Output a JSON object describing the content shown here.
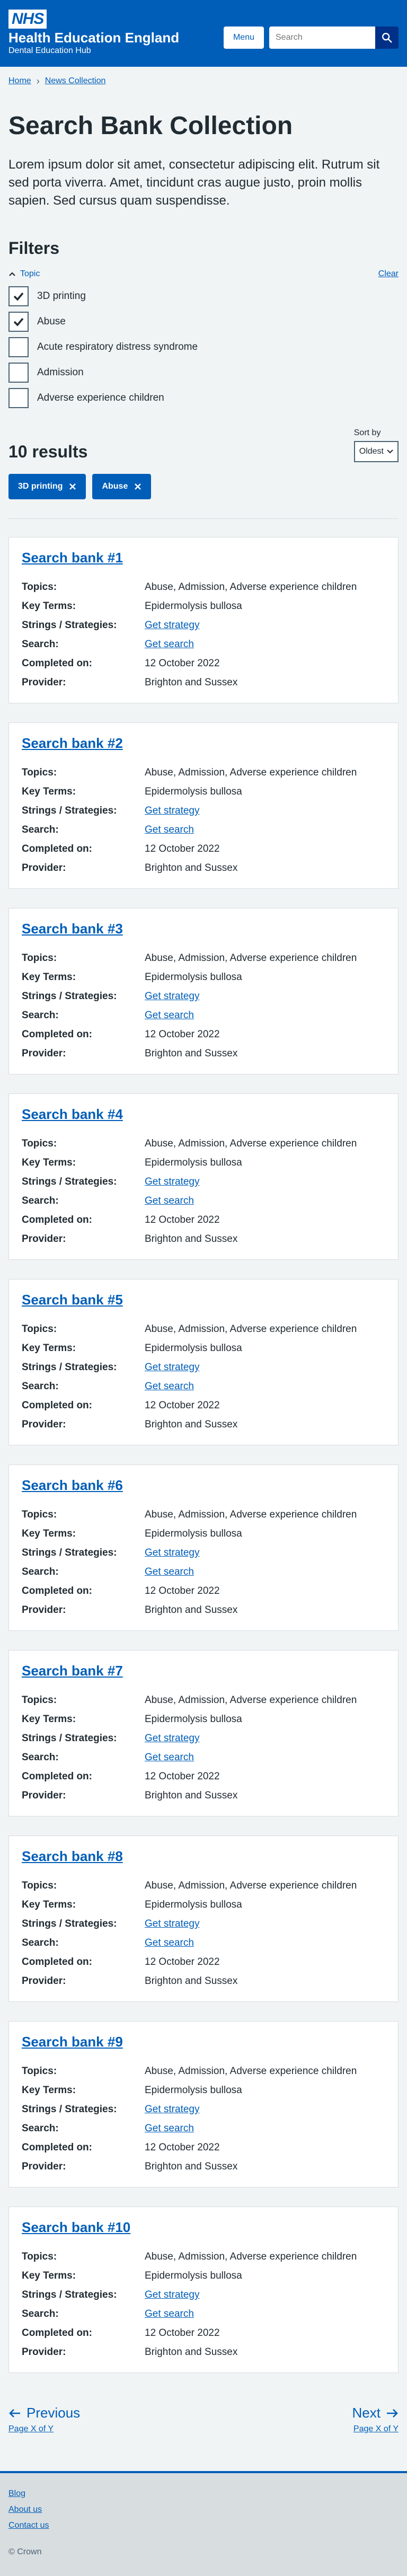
{
  "header": {
    "logo_text": "NHS",
    "org_name": "Health Education England",
    "org_sub": "Dental Education Hub",
    "menu_label": "Menu",
    "search_placeholder": "Search",
    "icons": {
      "search": "search-icon"
    },
    "colors": {
      "brand": "#005eb8",
      "dark": "#003087"
    }
  },
  "breadcrumb": {
    "items": [
      "Home",
      "News Collection"
    ]
  },
  "page": {
    "title": "Search Bank Collection",
    "lead": "Lorem ipsum dolor sit amet, consectetur adipiscing elit. Rutrum sit sed porta viverra. Amet, tincidunt cras augue justo, proin mollis sapien. Sed cursus quam suspendisse."
  },
  "filters": {
    "title": "Filters",
    "topic_label": "Topic",
    "clear_label": "Clear",
    "options": [
      {
        "label": "3D printing",
        "checked": true
      },
      {
        "label": "Abuse",
        "checked": true
      },
      {
        "label": "Acute respiratory distress syndrome",
        "checked": false
      },
      {
        "label": "Admission",
        "checked": false
      },
      {
        "label": "Adverse experience children",
        "checked": false
      }
    ]
  },
  "results": {
    "count_label": "10 results",
    "sort_label": "Sort by",
    "sort_value": "Oldest",
    "active_tags": [
      "3D printing",
      "Abuse"
    ]
  },
  "field_labels": {
    "topics": "Topics:",
    "key_terms": "Key Terms:",
    "strategies": "Strings / Strategies:",
    "search": "Search:",
    "completed": "Completed on:",
    "provider": "Provider:"
  },
  "cards": [
    {
      "title": "Search bank #1",
      "topics": "Abuse, Admission, Adverse experience children",
      "key_terms": "Epidermolysis bullosa",
      "strategy": "Get strategy",
      "search": "Get search",
      "completed": "12 October 2022",
      "provider": "Brighton and Sussex"
    },
    {
      "title": "Search bank #2",
      "topics": "Abuse, Admission, Adverse experience children",
      "key_terms": "Epidermolysis bullosa",
      "strategy": "Get strategy",
      "search": "Get search",
      "completed": "12 October 2022",
      "provider": "Brighton and Sussex"
    },
    {
      "title": "Search bank #3",
      "topics": "Abuse, Admission, Adverse experience children",
      "key_terms": "Epidermolysis bullosa",
      "strategy": "Get strategy",
      "search": "Get search",
      "completed": "12 October 2022",
      "provider": "Brighton and Sussex"
    },
    {
      "title": "Search bank #4",
      "topics": "Abuse, Admission, Adverse experience children",
      "key_terms": "Epidermolysis bullosa",
      "strategy": "Get strategy",
      "search": "Get search",
      "completed": "12 October 2022",
      "provider": "Brighton and Sussex"
    },
    {
      "title": "Search bank #5",
      "topics": "Abuse, Admission, Adverse experience children",
      "key_terms": "Epidermolysis bullosa",
      "strategy": "Get strategy",
      "search": "Get search",
      "completed": "12 October 2022",
      "provider": "Brighton and Sussex"
    },
    {
      "title": "Search bank #6",
      "topics": "Abuse, Admission, Adverse experience children",
      "key_terms": "Epidermolysis bullosa",
      "strategy": "Get strategy",
      "search": "Get search",
      "completed": "12 October 2022",
      "provider": "Brighton and Sussex"
    },
    {
      "title": "Search bank #7",
      "topics": "Abuse, Admission, Adverse experience children",
      "key_terms": "Epidermolysis bullosa",
      "strategy": "Get strategy",
      "search": "Get search",
      "completed": "12 October 2022",
      "provider": "Brighton and Sussex"
    },
    {
      "title": "Search bank #8",
      "topics": "Abuse, Admission, Adverse experience children",
      "key_terms": "Epidermolysis bullosa",
      "strategy": "Get strategy",
      "search": "Get search",
      "completed": "12 October 2022",
      "provider": "Brighton and Sussex"
    },
    {
      "title": "Search bank #9",
      "topics": "Abuse, Admission, Adverse experience children",
      "key_terms": "Epidermolysis bullosa",
      "strategy": "Get strategy",
      "search": "Get search",
      "completed": "12 October 2022",
      "provider": "Brighton and Sussex"
    },
    {
      "title": "Search bank #10",
      "topics": "Abuse, Admission, Adverse experience children",
      "key_terms": "Epidermolysis bullosa",
      "strategy": "Get strategy",
      "search": "Get search",
      "completed": "12 October 2022",
      "provider": "Brighton and Sussex"
    }
  ],
  "pagination": {
    "prev_label": "Previous",
    "prev_sub": "Page X of Y",
    "next_label": "Next",
    "next_sub": "Page X of Y"
  },
  "footer": {
    "links": [
      "Blog",
      "About us",
      "Contact us"
    ],
    "copyright": "© Crown"
  }
}
